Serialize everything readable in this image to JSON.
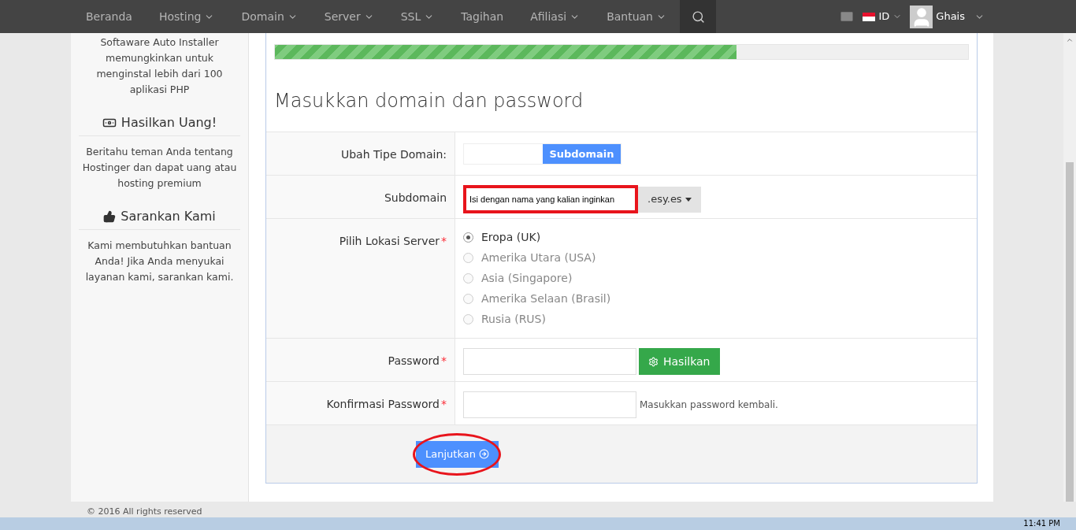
{
  "navbar": {
    "items": [
      {
        "label": "Beranda",
        "dropdown": false
      },
      {
        "label": "Hosting",
        "dropdown": true
      },
      {
        "label": "Domain",
        "dropdown": true
      },
      {
        "label": "Server",
        "dropdown": true
      },
      {
        "label": "SSL",
        "dropdown": true
      },
      {
        "label": "Tagihan",
        "dropdown": false
      },
      {
        "label": "Afiliasi",
        "dropdown": true
      },
      {
        "label": "Bantuan",
        "dropdown": true
      }
    ],
    "language": "ID",
    "user": "Ghais"
  },
  "sidebar": [
    {
      "kind": "text",
      "text": "Softaware Auto Installer memungkinkan untuk menginstal lebih dari 100 aplikasi PHP"
    },
    {
      "kind": "heading",
      "text": "Hasilkan Uang!"
    },
    {
      "kind": "text",
      "text": "Beritahu teman Anda tentang Hostinger dan dapat uang atau hosting premium"
    },
    {
      "kind": "heading",
      "text": "Sarankan Kami"
    },
    {
      "kind": "text",
      "text": "Kami membutuhkan bantuan Anda! Jika Anda menyukai layanan kami, sarankan kami."
    }
  ],
  "form": {
    "progress": {
      "level": 0.666
    },
    "title": "Masukkan domain dan password",
    "rows": [
      {
        "kind": "toggle",
        "label": "Ubah Tipe Domain:",
        "button": "Subdomain"
      },
      {
        "kind": "subdomain",
        "label": "Subdomain",
        "value": "Isi dengan nama yang kalian inginkan",
        "suffix": ".esy.es",
        "highlighted": true
      },
      {
        "kind": "radios",
        "label": "Pilih Lokasi Server",
        "required_mark": "*",
        "options": [
          {
            "label": "Eropa (UK)",
            "selected": true,
            "disabled": false
          },
          {
            "label": "Amerika Utara (USA)",
            "selected": false,
            "disabled": true
          },
          {
            "label": "Asia (Singapore)",
            "selected": false,
            "disabled": true
          },
          {
            "label": "Amerika Selaan (Brasil)",
            "selected": false,
            "disabled": true
          },
          {
            "label": "Rusia (RUS)",
            "selected": false,
            "disabled": true
          }
        ]
      },
      {
        "kind": "password",
        "label": "Password",
        "required_mark": "*",
        "button": "Hasilkan"
      },
      {
        "kind": "confirm",
        "label": "Konfirmasi Password",
        "required_mark": "*",
        "hint": "Masukkan password kembali."
      }
    ],
    "submit": {
      "label": "Lanjutkan",
      "highlighted": true
    }
  },
  "footer": "© 2016 All rights reserved",
  "taskbar": {
    "clock": "11:41 PM"
  }
}
